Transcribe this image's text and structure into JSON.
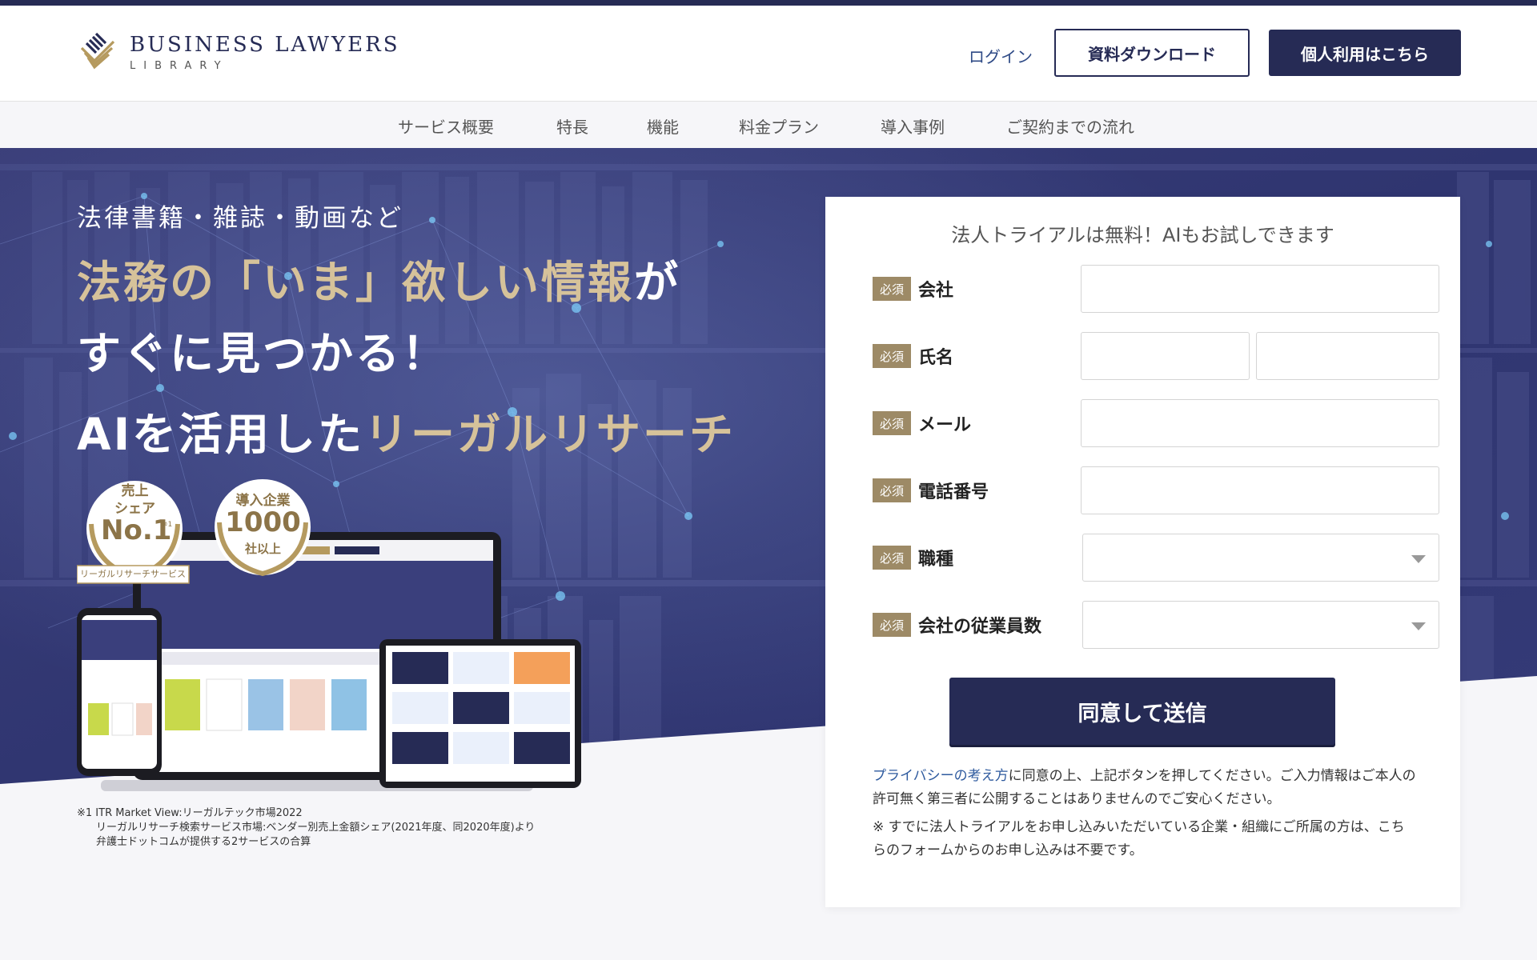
{
  "header": {
    "logo_main": "BUSINESS LAWYERS",
    "logo_sub": "LIBRARY",
    "login_label": "ログイン",
    "download_label": "資料ダウンロード",
    "personal_label": "個人利用はこちら"
  },
  "nav": {
    "items": [
      "サービス概要",
      "特長",
      "機能",
      "料金プラン",
      "導入事例",
      "ご契約までの流れ"
    ]
  },
  "hero": {
    "sub": "法律書籍・雑誌・動画など",
    "line1_gold": "法務の「いま」欲しい情報",
    "line1_white": "が",
    "line2": "すぐに見つかる！",
    "line3_white": "AIを活用した",
    "line3_gold": "リーガルリサーチ",
    "badge1": {
      "top": "売上",
      "mid": "シェア",
      "big": "No.1",
      "mark": "※1",
      "ribbon": "リーガルリサーチサービス"
    },
    "badge2": {
      "top": "導入企業",
      "big": "1000",
      "bottom": "社以上"
    },
    "footnote": [
      "※1 ITR Market View:リーガルテック市場2022",
      "リーガルリサーチ検索サービス市場:ベンダー別売上金額シェア(2021年度、同2020年度)より",
      "弁護士ドットコムが提供する2サービスの合算"
    ]
  },
  "form": {
    "title": "法人トライアルは無料！AIもお試しできます",
    "required_label": "必須",
    "fields": {
      "company": "会社",
      "name": "氏名",
      "email": "メール",
      "phone": "電話番号",
      "job": "職種",
      "employees": "会社の従業員数"
    },
    "submit_label": "同意して送信",
    "privacy_link": "プライバシーの考え方",
    "privacy_text": "に同意の上、上記ボタンを押してください。ご入力情報はご本人の許可無く第三者に公開することはありませんのでご安心ください。",
    "trial_note": "※ すでに法人トライアルをお申し込みいただいている企業・組織にご所属の方は、こちらのフォームからのお申し込みは不要です。"
  },
  "colors": {
    "navy": "#262b55",
    "gold": "#d6c29a",
    "required_badge": "#9d8a66",
    "link": "#2e5a9e"
  }
}
